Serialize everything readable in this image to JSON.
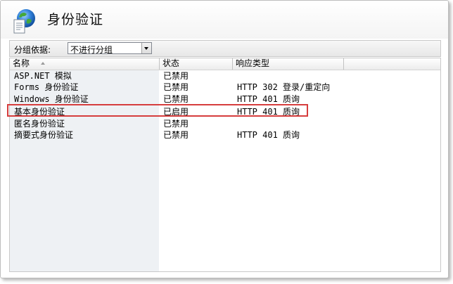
{
  "header": {
    "title": "身份验证",
    "icon": "globe-document-icon"
  },
  "group_by": {
    "label": "分组依据:",
    "value": "不进行分组"
  },
  "columns": {
    "name": "名称",
    "status": "状态",
    "response_type": "响应类型"
  },
  "rows": [
    {
      "name": "ASP.NET 模拟",
      "status": "已禁用",
      "response_type": ""
    },
    {
      "name": "Forms 身份验证",
      "status": "已禁用",
      "response_type": "HTTP 302 登录/重定向"
    },
    {
      "name": "Windows 身份验证",
      "status": "已禁用",
      "response_type": "HTTP 401 质询"
    },
    {
      "name": "基本身份验证",
      "status": "已启用",
      "response_type": "HTTP 401 质询"
    },
    {
      "name": "匿名身份验证",
      "status": "已禁用",
      "response_type": ""
    },
    {
      "name": "摘要式身份验证",
      "status": "已禁用",
      "response_type": "HTTP 401 质询"
    }
  ],
  "colors": {
    "highlight_border": "#d63d3d",
    "name_column_shade": "#eef1f4"
  }
}
